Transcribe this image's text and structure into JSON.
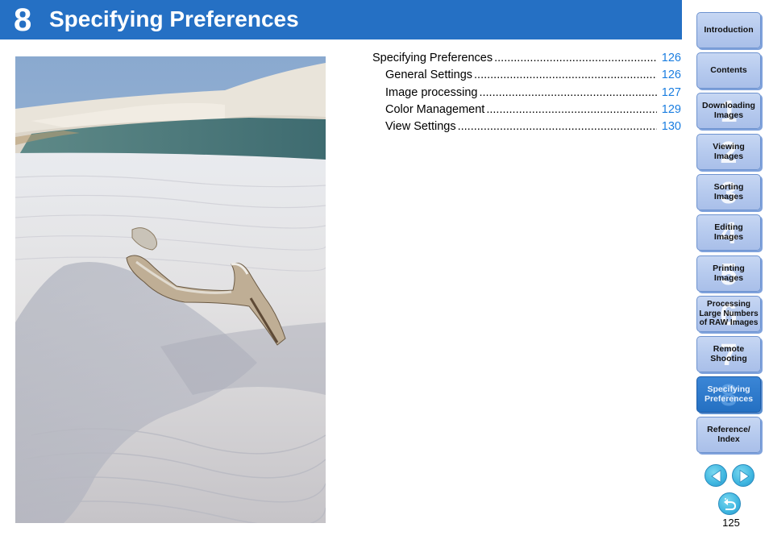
{
  "header": {
    "chapter_number": "8",
    "title": "Specifying Preferences",
    "color": "#2570c4"
  },
  "photo": {
    "description": "Driftwood half-buried in rippled white sand dunes with a blue-green lagoon and sky in the background"
  },
  "toc": [
    {
      "label": "Specifying Preferences",
      "page": "126",
      "level": 1
    },
    {
      "label": "General Settings",
      "page": "126",
      "level": 2
    },
    {
      "label": "Image processing",
      "page": "127",
      "level": 2
    },
    {
      "label": "Color Management",
      "page": "129",
      "level": 2
    },
    {
      "label": "View Settings",
      "page": "130",
      "level": 2
    }
  ],
  "nav": {
    "items": [
      {
        "label": "Introduction",
        "number": ""
      },
      {
        "label": "Contents",
        "number": ""
      },
      {
        "label": "Downloading Images",
        "number": "1"
      },
      {
        "label": "Viewing Images",
        "number": "2"
      },
      {
        "label": "Sorting Images",
        "number": "3"
      },
      {
        "label": "Editing Images",
        "number": "4"
      },
      {
        "label": "Printing Images",
        "number": "5"
      },
      {
        "label": "Processing Large Numbers of RAW Images",
        "number": "6"
      },
      {
        "label": "Remote Shooting",
        "number": "7"
      },
      {
        "label": "Specifying Preferences",
        "number": "8",
        "active": true
      },
      {
        "label": "Reference/ Index",
        "number": ""
      }
    ],
    "prev_icon": "arrow-left-icon",
    "next_icon": "arrow-right-icon",
    "back_icon": "return-icon",
    "accent": "#3fb6e0"
  },
  "page_number": "125"
}
